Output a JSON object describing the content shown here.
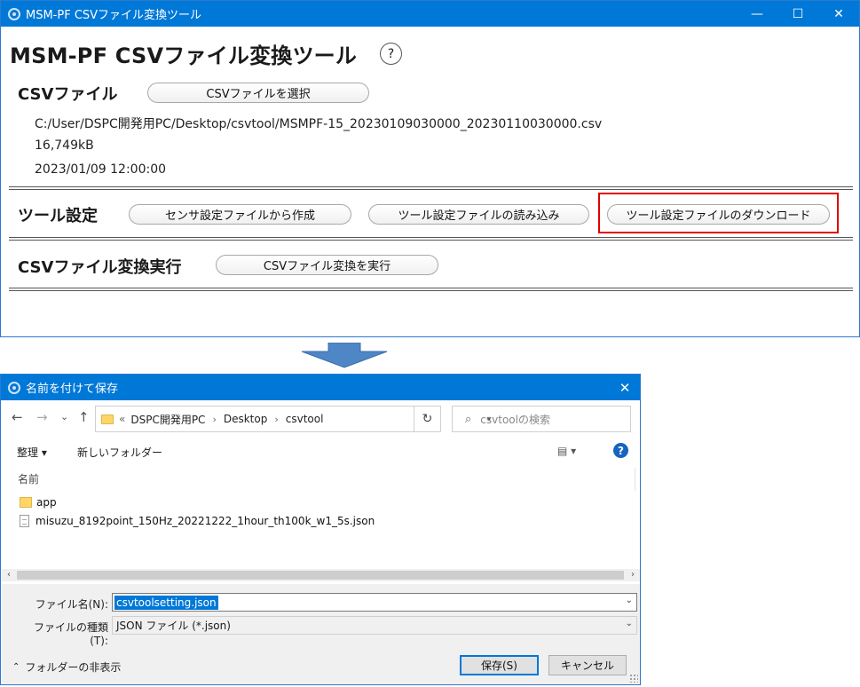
{
  "main_window": {
    "title": "MSM-PF CSVファイル変換ツール",
    "controls": {
      "minimize": "—",
      "maximize": "☐",
      "close": "✕"
    },
    "heading": "MSM-PF CSVファイル変換ツール",
    "help_label": "?",
    "csv_section": {
      "label": "CSVファイル",
      "select_button": "CSVファイルを選択",
      "path": "C:/User/DSPC開発用PC/Desktop/csvtool/MSMPF-15_20230109030000_20230110030000.csv",
      "size": "16,749kB",
      "datetime": "2023/01/09 12:00:00"
    },
    "tool_settings": {
      "label": "ツール設定",
      "create_button": "センサ設定ファイルから作成",
      "load_button": "ツール設定ファイルの読み込み",
      "download_button": "ツール設定ファイルのダウンロード",
      "highlight_color": "#e00000"
    },
    "convert_section": {
      "label": "CSVファイル変換実行",
      "run_button": "CSVファイル変換を実行"
    }
  },
  "arrow_color": "#4f86c6",
  "save_dialog": {
    "title": "名前を付けて保存",
    "close": "✕",
    "nav": {
      "back": "←",
      "forward": "→",
      "recent": "⌄",
      "up": "↑"
    },
    "breadcrumb": {
      "prefix": "«",
      "items": [
        "DSPC開発用PC",
        "Desktop",
        "csvtool"
      ],
      "sep": "›"
    },
    "refresh": "↻",
    "search_placeholder": "csvtoolの検索",
    "toolbar": {
      "organize": "整理 ▾",
      "new_folder": "新しいフォルダー",
      "view": "▤ ▾",
      "help": "?"
    },
    "column_header": "名前",
    "files": [
      {
        "name": "app",
        "type": "folder"
      },
      {
        "name": "misuzu_8192point_150Hz_20221222_1hour_th100k_w1_5s.json",
        "type": "file"
      }
    ],
    "filename_label": "ファイル名(N):",
    "filename_value": "csvtoolsetting.json",
    "filetype_label": "ファイルの種類(T):",
    "filetype_value": "JSON ファイル (*.json)",
    "hide_folders": "フォルダーの非表示",
    "save_button": "保存(S)",
    "cancel_button": "キャンセル",
    "accent_color": "#0078d7"
  }
}
